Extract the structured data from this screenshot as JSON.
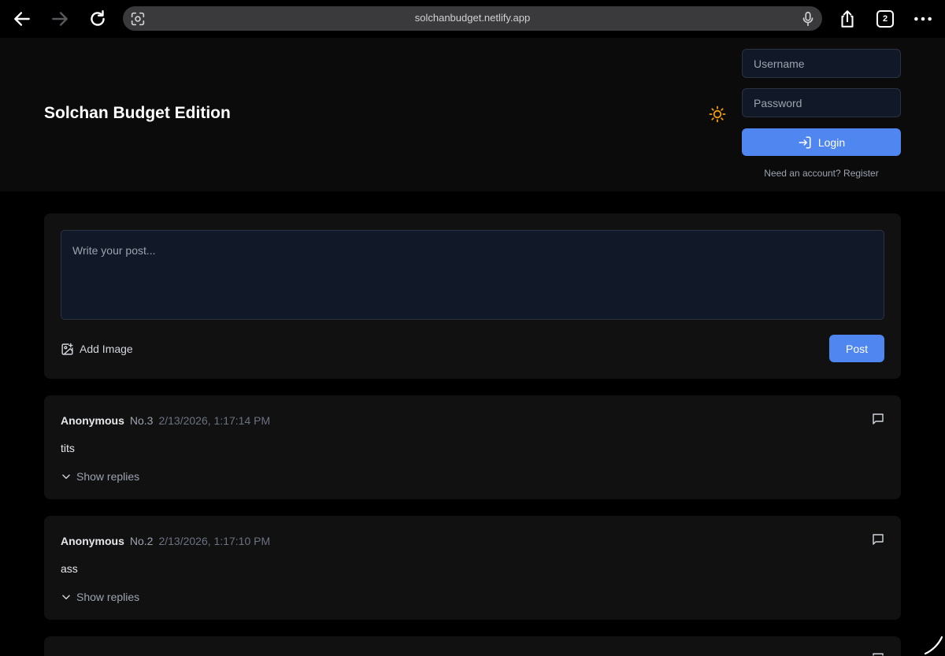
{
  "browser": {
    "url": "solchanbudget.netlify.app",
    "tab_count": "2",
    "icons": {
      "back": "arrow-left-icon",
      "forward": "arrow-right-icon",
      "reload": "reload-icon",
      "reader": "reader-scan-icon",
      "mic": "microphone-icon",
      "share": "share-icon",
      "tabs": "tabs-icon",
      "more": "more-dots-icon"
    }
  },
  "header": {
    "site_title": "Solchan Budget Edition",
    "theme_icon": "sun-icon",
    "username_placeholder": "Username",
    "password_placeholder": "Password",
    "login_label": "Login",
    "register_text": "Need an account? Register"
  },
  "compose": {
    "placeholder": "Write your post...",
    "add_image_label": "Add Image",
    "post_label": "Post"
  },
  "posts": [
    {
      "author": "Anonymous",
      "number": "No.3",
      "date": "2/13/2026, 1:17:14 PM",
      "body": "tits",
      "show_replies_label": "Show replies"
    },
    {
      "author": "Anonymous",
      "number": "No.2",
      "date": "2/13/2026, 1:17:10 PM",
      "body": "ass",
      "show_replies_label": "Show replies"
    }
  ],
  "colors": {
    "page_bg": "#000000",
    "header_bg": "#0b0b0b",
    "card_bg": "#111111",
    "input_bg": "#111827",
    "accent": "#4f86f0",
    "theme_icon": "#f59e0b"
  }
}
